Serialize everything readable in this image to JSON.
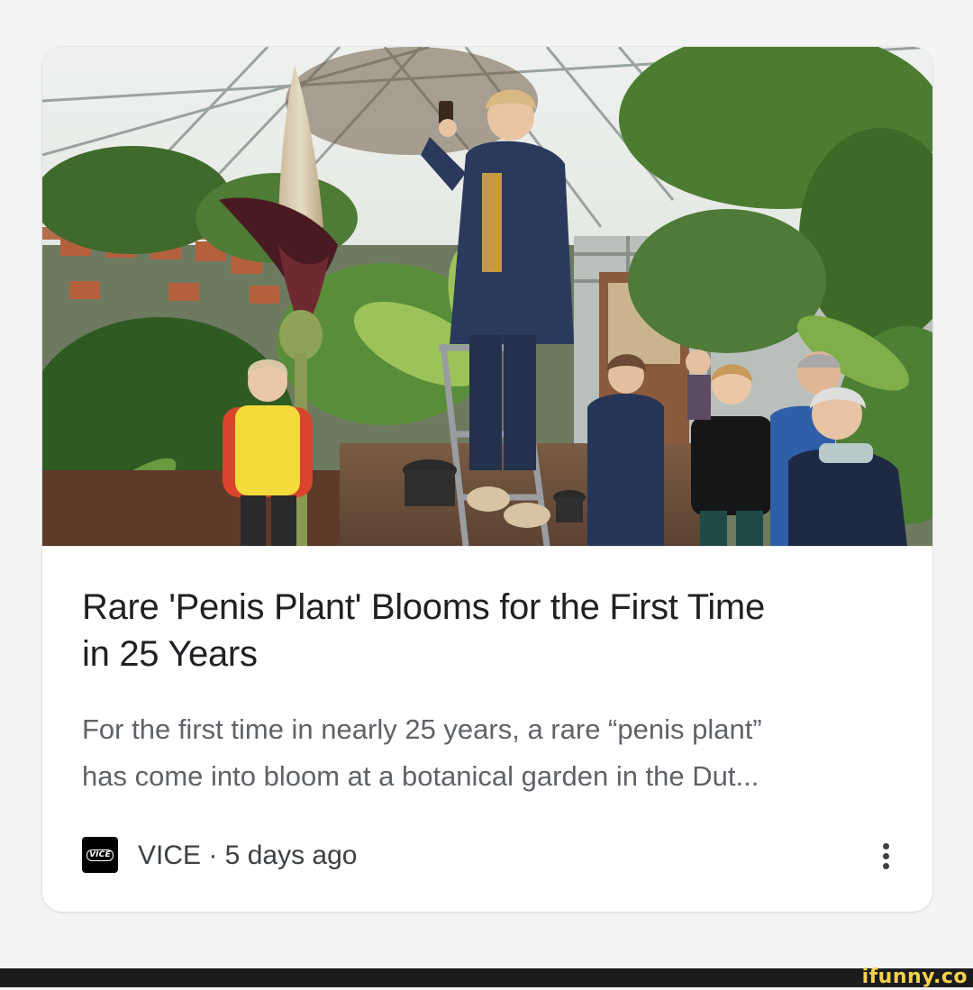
{
  "article": {
    "image_alt": "Woman on a ladder photographing a tall blooming plant in a greenhouse while onlookers watch",
    "headline_line1": "Rare 'Penis Plant' Blooms for the First Time",
    "headline_line2": "in 25 Years",
    "snippet_line1": "For the first time in nearly 25 years, a rare “penis plant”",
    "snippet_line2": "has come into bloom at a botanical garden in the Dut...",
    "source_logo_text": "VICE",
    "meta": "VICE · 5 days ago"
  },
  "watermark": "ifunny.co",
  "colors": {
    "page_bg": "#f4f4f5",
    "card_bg": "#ffffff",
    "headline": "#202124",
    "snippet": "#5f6368",
    "watermark": "#f8d24a"
  },
  "icons": {
    "more": "vertical-ellipsis-icon",
    "source": "vice-logo-icon"
  }
}
